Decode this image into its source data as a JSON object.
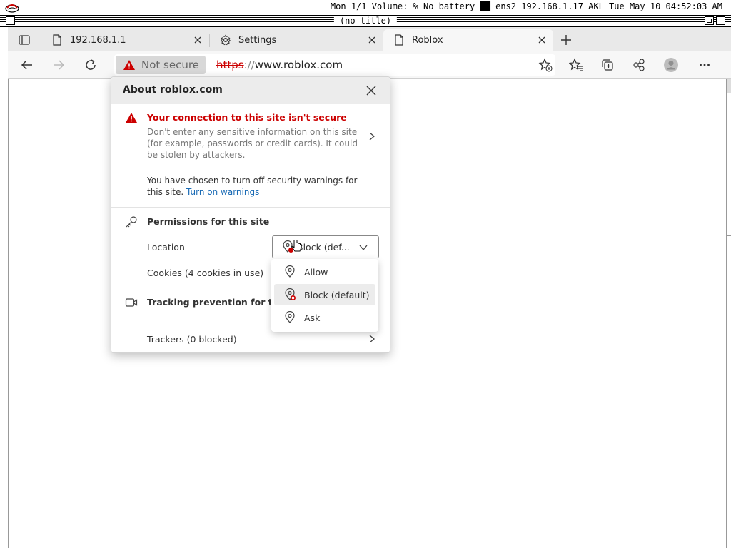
{
  "system_bar": {
    "status": "Mon 1/1 Volume: % No battery ██ ens2 192.168.1.17 AKL Tue May 10 04:52:03 AM"
  },
  "window": {
    "title": "(no title)"
  },
  "tabs": [
    {
      "label": "192.168.1.1",
      "icon": "page-icon"
    },
    {
      "label": "Settings",
      "icon": "gear-icon"
    },
    {
      "label": "Roblox",
      "icon": "page-icon",
      "active": true
    }
  ],
  "address_bar": {
    "not_secure": "Not secure",
    "url_scheme": "https",
    "url_sep": "://",
    "url_host": "www.roblox.com"
  },
  "popup": {
    "title": "About roblox.com",
    "warning_title": "Your connection to this site isn't secure",
    "warning_body": "Don't enter any sensitive information on this site (for example, passwords or credit cards). It could be stolen by attackers.",
    "choice_text": "You have chosen to turn off security warnings for this site. ",
    "turn_on_link": "Turn on warnings",
    "permissions_title": "Permissions for this site",
    "location_label": "Location",
    "location_value": "Block (def...",
    "cookies": "Cookies (4 cookies in use)",
    "tracking_title": "Tracking prevention for this site (Balanced)",
    "trackers": "Trackers (0 blocked)"
  },
  "location_options": [
    {
      "label": "Allow"
    },
    {
      "label": "Block (default)",
      "selected": true
    },
    {
      "label": "Ask"
    }
  ],
  "colors": {
    "warning_red": "#c00000",
    "link_blue": "#1a6bb5"
  }
}
